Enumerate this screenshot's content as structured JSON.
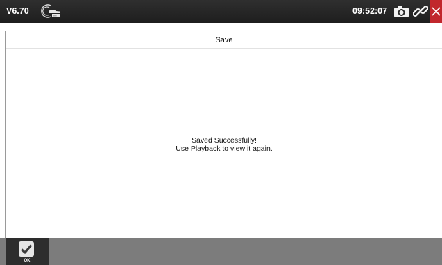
{
  "topbar": {
    "version": "V6.70",
    "logo_icon": "vehicle-vin-icon",
    "clock": "09:52:07",
    "camera_icon": "camera-icon",
    "link_icon": "link-icon",
    "close_icon": "close-icon",
    "close_color": "#c1272d"
  },
  "page": {
    "title": "Save",
    "message_line1": "Saved Successfully!",
    "message_line2": "Use Playback to view it again."
  },
  "toolbar": {
    "ok_icon": "checkmark-icon",
    "ok_label": "OK"
  }
}
